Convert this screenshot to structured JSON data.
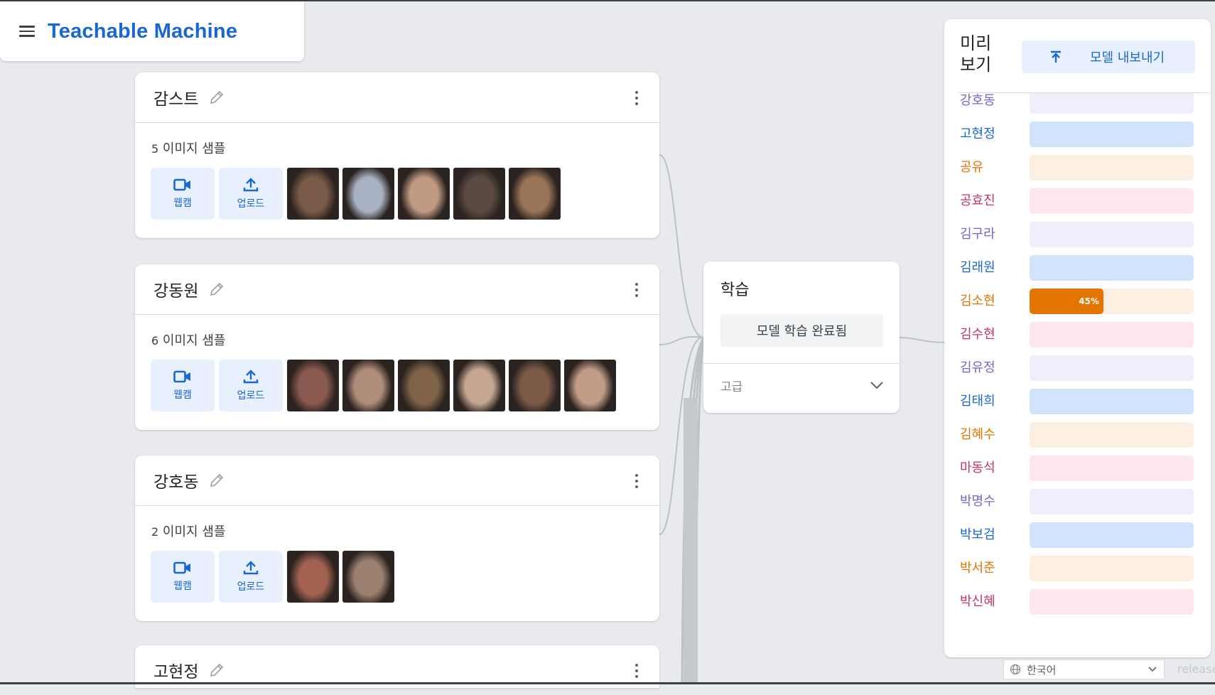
{
  "app": {
    "title": "Teachable Machine"
  },
  "classes": [
    {
      "name": "감스트",
      "count": "5",
      "samples_label": "이미지 샘플",
      "webcam": "웹캠",
      "upload": "업로드",
      "thumbs": [
        "#7a5a48",
        "#a9b2c4",
        "#c09a82",
        "#5a4a42",
        "#9a7456"
      ]
    },
    {
      "name": "강동원",
      "count": "6",
      "samples_label": "이미지 샘플",
      "webcam": "웹캠",
      "upload": "업로드",
      "thumbs": [
        "#8a5a50",
        "#b08d7a",
        "#7f6248",
        "#c4a692",
        "#7d5a48",
        "#c29c86"
      ]
    },
    {
      "name": "강호동",
      "count": "2",
      "samples_label": "이미지 샘플",
      "webcam": "웹캠",
      "upload": "업로드",
      "thumbs": [
        "#a36250",
        "#9c8070"
      ]
    },
    {
      "name": "고현정"
    }
  ],
  "training": {
    "title": "학습",
    "button": "모델 학습 완료됨",
    "advanced": "고급"
  },
  "preview": {
    "title": "미리 보기",
    "export": "모델 내보내기",
    "rows": [
      {
        "name": "강호동",
        "value": 0,
        "color": "#7b61c9",
        "bg": "#efeffb",
        "fill": "#7b61c9"
      },
      {
        "name": "고현정",
        "value": 0,
        "color": "#1967d2",
        "bg": "#d2e3fc",
        "fill": "#1967d2"
      },
      {
        "name": "공유",
        "value": 0,
        "color": "#e37400",
        "bg": "#feefe3",
        "fill": "#e37400"
      },
      {
        "name": "공효진",
        "value": 0,
        "color": "#c5336c",
        "bg": "#fde7ec",
        "fill": "#c5336c"
      },
      {
        "name": "김구라",
        "value": 0,
        "color": "#7b61c9",
        "bg": "#efeffb",
        "fill": "#7b61c9"
      },
      {
        "name": "김래원",
        "value": 0,
        "color": "#1967d2",
        "bg": "#d2e3fc",
        "fill": "#1967d2"
      },
      {
        "name": "김소현",
        "value": 45,
        "label": "45%",
        "color": "#e37400",
        "bg": "#feefe3",
        "fill": "#e37400"
      },
      {
        "name": "김수현",
        "value": 0,
        "color": "#c5336c",
        "bg": "#fde7ec",
        "fill": "#c5336c"
      },
      {
        "name": "김유정",
        "value": 0,
        "color": "#7b61c9",
        "bg": "#efeffb",
        "fill": "#7b61c9"
      },
      {
        "name": "김태희",
        "value": 0,
        "color": "#1967d2",
        "bg": "#d2e3fc",
        "fill": "#1967d2"
      },
      {
        "name": "김혜수",
        "value": 0,
        "color": "#e37400",
        "bg": "#feefe3",
        "fill": "#e37400"
      },
      {
        "name": "마동석",
        "value": 0,
        "color": "#c5336c",
        "bg": "#fde7ec",
        "fill": "#c5336c"
      },
      {
        "name": "박명수",
        "value": 0,
        "color": "#7b61c9",
        "bg": "#efeffb",
        "fill": "#7b61c9"
      },
      {
        "name": "박보검",
        "value": 0,
        "color": "#1967d2",
        "bg": "#d2e3fc",
        "fill": "#1967d2"
      },
      {
        "name": "박서준",
        "value": 0,
        "color": "#e37400",
        "bg": "#feefe3",
        "fill": "#e37400"
      },
      {
        "name": "박신혜",
        "value": 0,
        "color": "#c5336c",
        "bg": "#fde7ec",
        "fill": "#c5336c"
      }
    ]
  },
  "footer": {
    "language": "한국어",
    "release": "release"
  }
}
